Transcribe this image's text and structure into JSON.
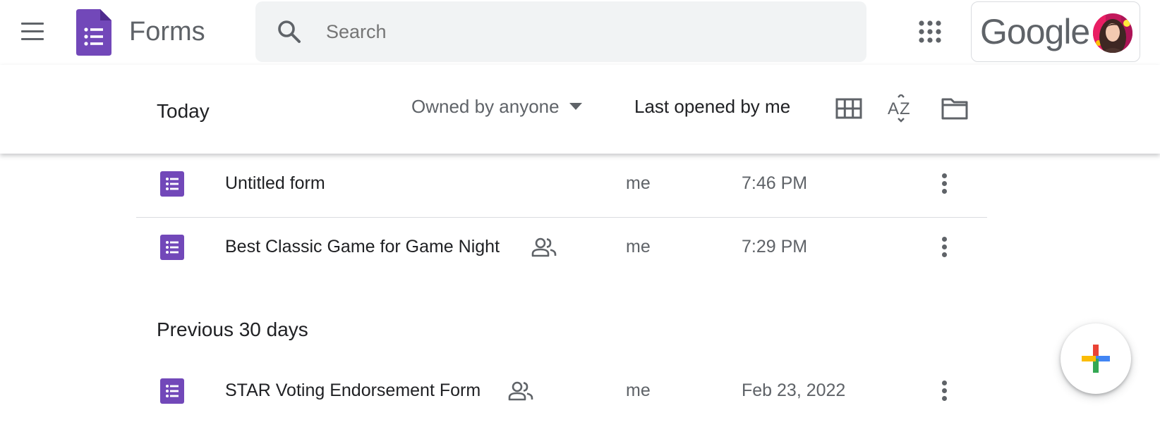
{
  "app": {
    "name": "Forms",
    "logo_icon": "forms-logo-icon"
  },
  "colors": {
    "forms_purple": "#7248b9",
    "text_primary": "#202124",
    "text_secondary": "#5f6368",
    "search_bg": "#f1f3f4"
  },
  "search": {
    "placeholder": "Search",
    "value": ""
  },
  "account": {
    "brand": "Google"
  },
  "toolbar": {
    "section_title": "Today",
    "owner_filter": "Owned by anyone",
    "sort_label": "Last opened by me"
  },
  "sections": {
    "today": {
      "rows": [
        {
          "title": "Untitled form",
          "shared": false,
          "owner": "me",
          "date": "7:46 PM"
        },
        {
          "title": "Best Classic Game for Game Night",
          "shared": true,
          "owner": "me",
          "date": "7:29 PM"
        }
      ]
    },
    "previous": {
      "label": "Previous 30 days",
      "rows": [
        {
          "title": "STAR Voting Endorsement Form",
          "shared": true,
          "owner": "me",
          "date": "Feb 23, 2022"
        }
      ]
    }
  },
  "fab": {
    "icon": "plus-icon"
  }
}
